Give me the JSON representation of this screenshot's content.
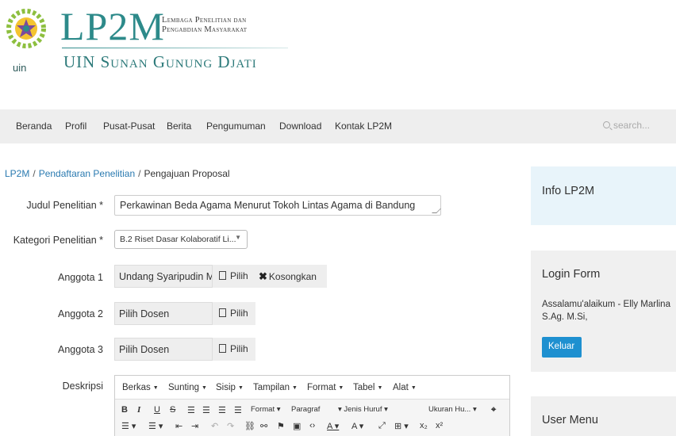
{
  "header": {
    "title": "LP2M",
    "subtitle_line1": "Lembaga Penelitian dan",
    "subtitle_line2": "Pengabdian Masyarakat",
    "institution": "UIN Sunan Gunung Djati",
    "emblem_text": "uin",
    "accent_color": "#2d8a8a"
  },
  "nav": {
    "items": [
      "Beranda",
      "Profil",
      "Pusat-Pusat",
      "Berita",
      "Pengumuman",
      "Download",
      "Kontak LP2M"
    ],
    "search_placeholder": "search..."
  },
  "breadcrumb": {
    "items": [
      "LP2M",
      "Pendaftaran Penelitian",
      "Pengajuan Proposal"
    ]
  },
  "form": {
    "judul_label": "Judul Penelitian *",
    "judul_value": "Perkawinan Beda Agama Menurut Tokoh Lintas Agama di Bandung",
    "kategori_label": "Kategori Penelitian *",
    "kategori_value": "B.2 Riset Dasar Kolaboratif Li...",
    "anggota": [
      {
        "label": "Anggota 1",
        "value": "Undang Syaripudin M.Kom",
        "pilih": "Pilih",
        "kosongkan": "Kosongkan"
      },
      {
        "label": "Anggota 2",
        "value": "Pilih Dosen",
        "pilih": "Pilih"
      },
      {
        "label": "Anggota 3",
        "value": "Pilih Dosen",
        "pilih": "Pilih"
      }
    ],
    "deskripsi_label": "Deskripsi"
  },
  "editor": {
    "menus": [
      "Berkas",
      "Sunting",
      "Sisip",
      "Tampilan",
      "Format",
      "Tabel",
      "Alat"
    ],
    "format_dropdowns": [
      "Format",
      "Paragraf",
      "Jenis Huruf",
      "Ukuran Hu..."
    ]
  },
  "sidebar": {
    "info_title": "Info LP2M",
    "login_title": "Login Form",
    "greeting": "Assalamu'alaikum - Elly Marlina S.Ag. M.Si,",
    "logout_label": "Keluar",
    "user_menu_title": "User Menu"
  },
  "colors": {
    "link": "#2a7ab0",
    "button_primary": "#1e90d0",
    "info_bg": "#e8f4fa"
  }
}
